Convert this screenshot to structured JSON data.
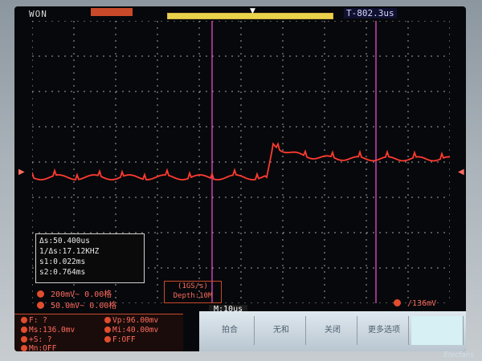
{
  "header": {
    "brand": "WON",
    "trigger_state": "",
    "trigger_time": "T-802.3us"
  },
  "measurements": {
    "delta_t": "Δs:50.400us",
    "inv_delta_t": "1/Δs:17.12KHZ",
    "cursor_s1": "s1:0.022ms",
    "cursor_s2": "s2:0.764ms"
  },
  "channels": {
    "ch1": "200mV~ 0.00格",
    "ch2": "50.0mV~ 0.00格"
  },
  "sample": {
    "rate": "(1GS/s)",
    "depth": "Depth:10M"
  },
  "timebase": "M:10us",
  "trigger_level": "/136mV",
  "auto_measure": {
    "freq": "F: ?",
    "vp": "Vp:96.00mv",
    "ms": "Ms:136.0mv",
    "mi": "Mi:40.00mv",
    "plus_s": "+S: ?",
    "f_off": "F:OFF",
    "m_off": "Mn:OFF"
  },
  "softkeys": [
    "拍合",
    "无和",
    "关闭",
    "更多选项",
    ""
  ],
  "watermark": "Elecfans",
  "colors": {
    "trace": "#ff3b30",
    "cursor": "#ff4fd8",
    "grid": "#d8d8d8",
    "accent": "#c94a2a"
  },
  "icons": {
    "channel_marker": "circle-icon",
    "trigger_marker": "triangle-down-icon",
    "ground_marker": "arrow-right-icon"
  }
}
